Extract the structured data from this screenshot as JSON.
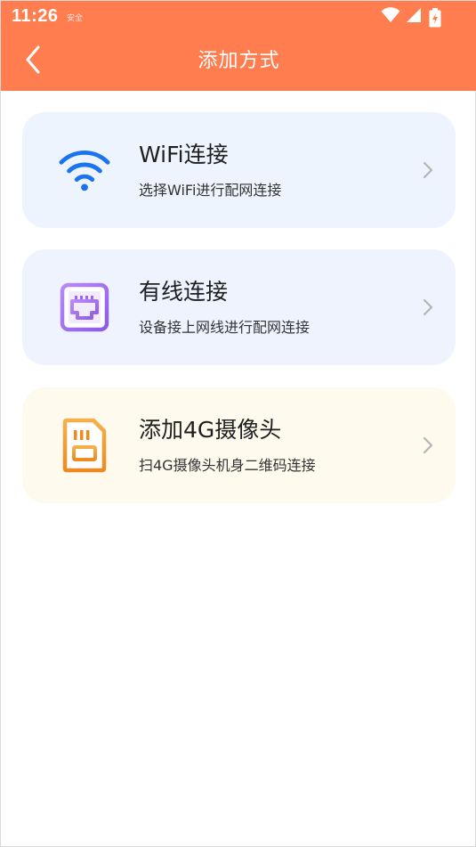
{
  "status_bar": {
    "time": "11:26",
    "small_label": "安全",
    "icons": [
      "wifi-icon",
      "signal-icon",
      "battery-icon"
    ]
  },
  "header": {
    "title": "添加方式",
    "back_icon": "chevron-left-icon"
  },
  "options": [
    {
      "title": "WiFi连接",
      "subtitle": "选择WiFi进行配网连接",
      "icon": "wifi-icon",
      "icon_color": "#1a73f0"
    },
    {
      "title": "有线连接",
      "subtitle": "设备接上网线进行配网连接",
      "icon": "ethernet-port-icon",
      "icon_color": "#9a6af0"
    },
    {
      "title": "添加4G摄像头",
      "subtitle": "扫4G摄像头机身二维码连接",
      "icon": "sim-card-icon",
      "icon_color": "#f0922a"
    }
  ],
  "colors": {
    "header_bg": "#ff7d4f",
    "card_blue": "#eef4fd",
    "card_yellow": "#fefaee",
    "chevron": "#b5b5b5"
  }
}
